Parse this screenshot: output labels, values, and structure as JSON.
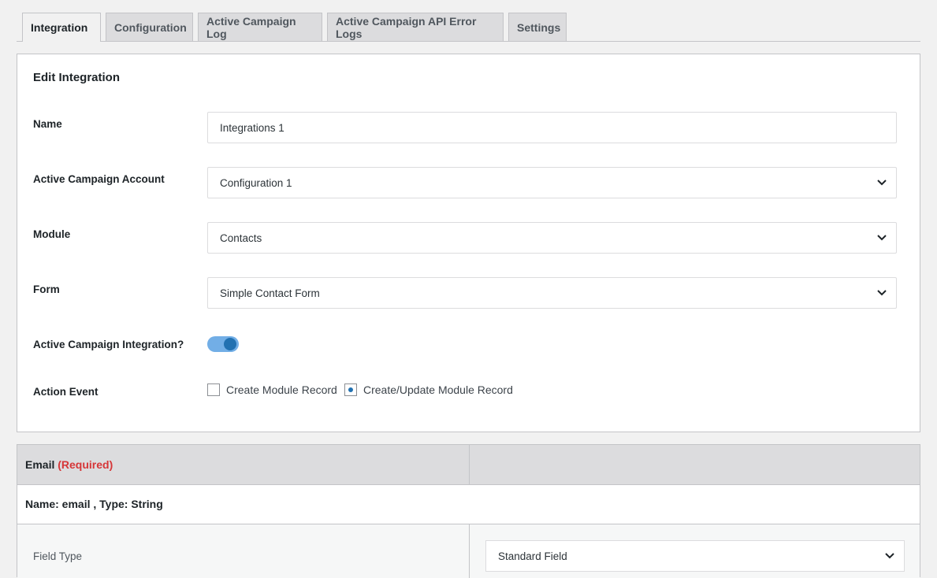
{
  "tabs": [
    {
      "label": "Integration",
      "active": true
    },
    {
      "label": "Configuration",
      "active": false
    },
    {
      "label": "Active Campaign Log",
      "active": false
    },
    {
      "label": "Active Campaign API Error Logs",
      "active": false
    },
    {
      "label": "Settings",
      "active": false
    }
  ],
  "card": {
    "title": "Edit Integration",
    "name_label": "Name",
    "name_value": "Integrations 1",
    "account_label": "Active Campaign Account",
    "account_value": "Configuration 1",
    "module_label": "Module",
    "module_value": "Contacts",
    "form_label": "Form",
    "form_value": "Simple Contact Form",
    "integration_label": "Active Campaign Integration?",
    "integration_enabled": true,
    "action_label": "Action Event",
    "action_options": [
      {
        "label": "Create Module Record",
        "checked": false
      },
      {
        "label": "Create/Update Module Record",
        "checked": true
      }
    ]
  },
  "mapping": {
    "field_name": "Email",
    "required_label": "(Required)",
    "meta": "Name: email , Type: String",
    "field_type_label": "Field Type",
    "field_type_value": "Standard Field"
  },
  "colors": {
    "accent": "#2271b1",
    "toggle_track": "#72aee6",
    "required": "#d63638"
  },
  "icons": {
    "select": "chevron-down-icon"
  }
}
